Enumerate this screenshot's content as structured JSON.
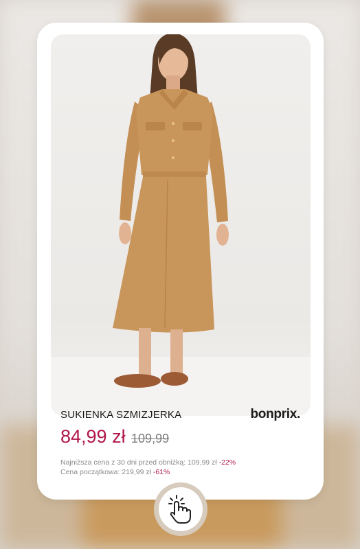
{
  "product": {
    "name": "SUKIENKA SZMIZJERKA",
    "brand": "bonprix.",
    "price": "84,99 zł",
    "old_price": "109,99",
    "lowest_price_label": "Najniższa cena z 30 dni  przed obniżką: 109,99 zł",
    "lowest_price_discount": "-22%",
    "initial_price_label": "Cena początkowa: 219,99 zł",
    "initial_price_discount": "-61%"
  },
  "icons": {
    "cta": "hand-pointer-click-icon"
  },
  "colors": {
    "price": "#b0174a",
    "discount": "#b0174a",
    "dress": "#c8955a",
    "card": "#ffffff"
  }
}
